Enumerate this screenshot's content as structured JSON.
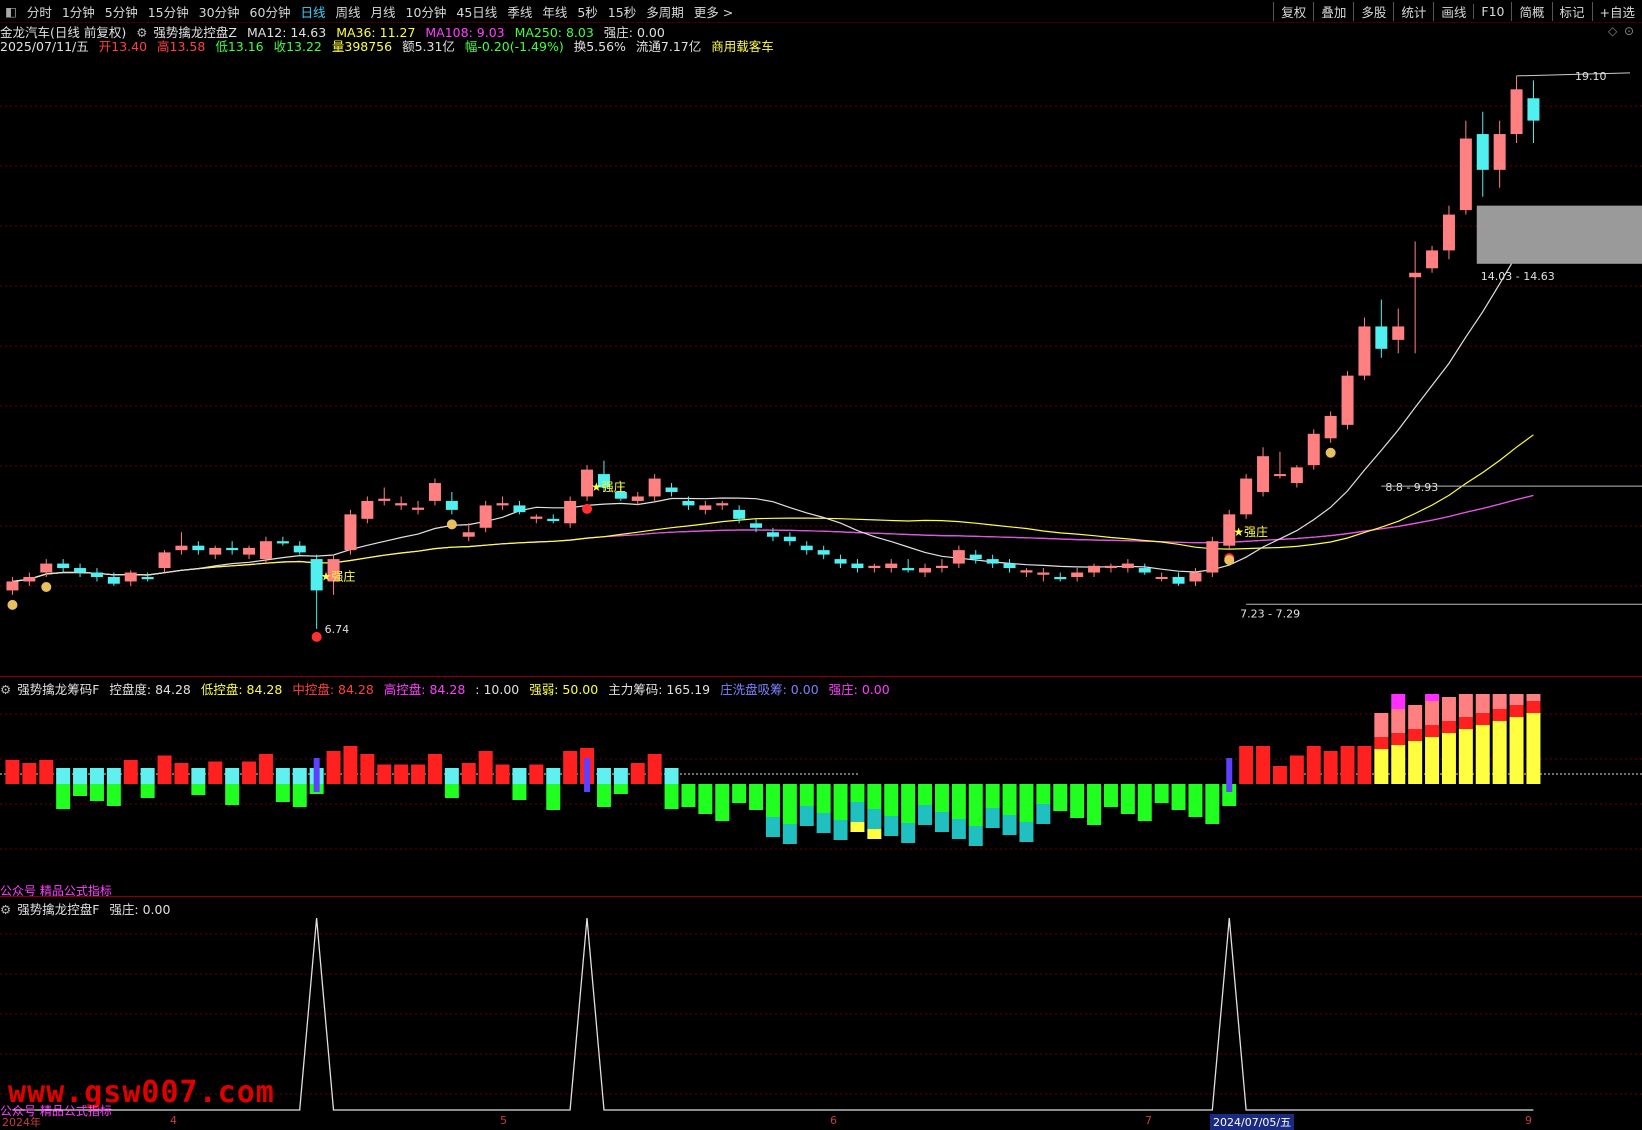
{
  "toolbar": {
    "periods": [
      "分时",
      "1分钟",
      "5分钟",
      "15分钟",
      "30分钟",
      "60分钟",
      "日线",
      "周线",
      "月线",
      "10分钟",
      "45日线",
      "季线",
      "年线",
      "5秒",
      "15秒",
      "多周期",
      "更多 >"
    ],
    "active": "日线",
    "right_items": [
      "复权",
      "叠加",
      "多股",
      "统计",
      "画线",
      "F10",
      "简概",
      "标记",
      "+自选"
    ]
  },
  "price_header": {
    "stock": "金龙汽车(日线 前复权)",
    "indicator": "强势擒龙控盘Z",
    "ma12": "MA12: 14.63",
    "ma36": "MA36: 11.27",
    "ma108": "MA108: 9.03",
    "ma250": "MA250: 8.03",
    "qz": "强庄: 0.00"
  },
  "info_line": {
    "date": "2025/07/11/五",
    "open": "开13.40",
    "high": "高13.58",
    "low": "低13.16",
    "close": "收13.22",
    "vol": "量398756",
    "amount": "额5.31亿",
    "change": "幅-0.20(-1.49%)",
    "turnover": "换5.56%",
    "float": "流通7.17亿",
    "sector": "商用载客车"
  },
  "price_labels": {
    "high": "19.10",
    "low": "6.74",
    "zone1": "14.03 - 14.63",
    "zone2": "8.8 - 9.93",
    "zone3": "7.23 - 7.29",
    "qz_tag": "★强庄"
  },
  "ind1_header": {
    "name": "强势擒龙筹码F",
    "kpd": "控盘度: 84.28",
    "low": "低控盘: 84.28",
    "mid": "中控盘: 84.28",
    "high": "高控盘: 84.28",
    "ten": ": 10.00",
    "qr": "强弱: 50.00",
    "zl": "主力筹码: 165.19",
    "wash": "庄洗盘吸筹: 0.00",
    "qz": "强庄: 0.00"
  },
  "ind2_header": {
    "name": "强势擒龙控盘F",
    "qz": "强庄: 0.00"
  },
  "watermark": {
    "site": "www.gsw007.com",
    "caption": "公众号 精品公式指标"
  },
  "time_axis": [
    "2024年",
    "4",
    "5",
    "6",
    "7",
    "2024/07/05/五",
    "9"
  ],
  "colors": {
    "up": "#ff8080",
    "up_solid": "#ff2020",
    "down": "#50f0f0",
    "ma12": "#e0e0e0",
    "ma36": "#ffff40",
    "ma108": "#ff40ff",
    "ma250": "#40ff40"
  },
  "chart_data": {
    "type": "candlestick",
    "price_range": [
      6.0,
      19.5
    ],
    "candles_ohlc": [
      [
        7.6,
        7.9,
        7.5,
        7.8
      ],
      [
        7.8,
        8.0,
        7.7,
        7.9
      ],
      [
        8.0,
        8.3,
        7.9,
        8.2
      ],
      [
        8.2,
        8.3,
        8.0,
        8.1
      ],
      [
        8.1,
        8.2,
        7.9,
        8.0
      ],
      [
        8.0,
        8.1,
        7.8,
        7.9
      ],
      [
        7.9,
        8.0,
        7.7,
        7.75
      ],
      [
        7.8,
        8.05,
        7.7,
        8.0
      ],
      [
        7.9,
        8.0,
        7.8,
        7.85
      ],
      [
        8.1,
        8.5,
        8.0,
        8.45
      ],
      [
        8.5,
        8.9,
        8.4,
        8.6
      ],
      [
        8.6,
        8.7,
        8.4,
        8.5
      ],
      [
        8.4,
        8.6,
        8.3,
        8.55
      ],
      [
        8.55,
        8.7,
        8.4,
        8.5
      ],
      [
        8.4,
        8.6,
        8.3,
        8.55
      ],
      [
        8.3,
        8.8,
        8.2,
        8.7
      ],
      [
        8.7,
        8.8,
        8.6,
        8.65
      ],
      [
        8.6,
        8.7,
        8.4,
        8.45
      ],
      [
        8.3,
        8.4,
        6.74,
        7.6
      ],
      [
        7.8,
        8.4,
        7.5,
        8.3
      ],
      [
        8.5,
        9.4,
        8.4,
        9.3
      ],
      [
        9.2,
        9.7,
        9.1,
        9.6
      ],
      [
        9.6,
        9.9,
        9.5,
        9.65
      ],
      [
        9.5,
        9.7,
        9.4,
        9.55
      ],
      [
        9.4,
        9.6,
        9.3,
        9.45
      ],
      [
        9.6,
        10.1,
        9.5,
        10.0
      ],
      [
        9.6,
        9.8,
        9.3,
        9.4
      ],
      [
        8.8,
        9.1,
        8.7,
        8.9
      ],
      [
        9.0,
        9.6,
        8.9,
        9.5
      ],
      [
        9.5,
        9.7,
        9.4,
        9.55
      ],
      [
        9.5,
        9.6,
        9.3,
        9.35
      ],
      [
        9.2,
        9.3,
        9.1,
        9.25
      ],
      [
        9.2,
        9.3,
        9.1,
        9.15
      ],
      [
        9.1,
        9.7,
        9.0,
        9.6
      ],
      [
        9.7,
        10.4,
        9.6,
        10.3
      ],
      [
        10.2,
        10.5,
        9.8,
        9.9
      ],
      [
        9.8,
        10.0,
        9.6,
        9.65
      ],
      [
        9.6,
        9.8,
        9.5,
        9.7
      ],
      [
        9.7,
        10.2,
        9.6,
        10.1
      ],
      [
        9.9,
        10.0,
        9.7,
        9.8
      ],
      [
        9.6,
        9.7,
        9.4,
        9.5
      ],
      [
        9.4,
        9.6,
        9.3,
        9.5
      ],
      [
        9.5,
        9.6,
        9.4,
        9.55
      ],
      [
        9.4,
        9.5,
        9.1,
        9.2
      ],
      [
        9.1,
        9.2,
        8.9,
        9.0
      ],
      [
        8.9,
        9.0,
        8.7,
        8.8
      ],
      [
        8.8,
        8.9,
        8.6,
        8.7
      ],
      [
        8.6,
        8.7,
        8.4,
        8.5
      ],
      [
        8.5,
        8.6,
        8.3,
        8.4
      ],
      [
        8.3,
        8.4,
        8.1,
        8.2
      ],
      [
        8.2,
        8.3,
        8.0,
        8.1
      ],
      [
        8.1,
        8.2,
        8.0,
        8.15
      ],
      [
        8.1,
        8.3,
        8.0,
        8.2
      ],
      [
        8.1,
        8.3,
        8.0,
        8.05
      ],
      [
        8.0,
        8.2,
        7.9,
        8.1
      ],
      [
        8.1,
        8.3,
        8.0,
        8.15
      ],
      [
        8.2,
        8.6,
        8.1,
        8.5
      ],
      [
        8.4,
        8.5,
        8.2,
        8.3
      ],
      [
        8.3,
        8.4,
        8.1,
        8.2
      ],
      [
        8.2,
        8.3,
        8.0,
        8.1
      ],
      [
        8.0,
        8.1,
        7.9,
        8.05
      ],
      [
        7.95,
        8.1,
        7.8,
        8.0
      ],
      [
        7.9,
        8.0,
        7.8,
        7.85
      ],
      [
        7.9,
        8.1,
        7.8,
        8.0
      ],
      [
        8.0,
        8.2,
        7.9,
        8.15
      ],
      [
        8.1,
        8.2,
        8.0,
        8.15
      ],
      [
        8.1,
        8.3,
        8.0,
        8.2
      ],
      [
        8.1,
        8.2,
        7.95,
        8.0
      ],
      [
        7.9,
        8.0,
        7.8,
        7.9
      ],
      [
        7.9,
        8.0,
        7.7,
        7.75
      ],
      [
        7.8,
        8.1,
        7.7,
        8.0
      ],
      [
        8.0,
        8.8,
        7.9,
        8.7
      ],
      [
        8.6,
        9.4,
        8.5,
        9.3
      ],
      [
        9.3,
        10.2,
        9.2,
        10.1
      ],
      [
        9.8,
        10.8,
        9.7,
        10.6
      ],
      [
        10.2,
        10.7,
        10.1,
        10.2
      ],
      [
        10.0,
        10.4,
        9.9,
        10.35
      ],
      [
        10.4,
        11.2,
        10.3,
        11.1
      ],
      [
        11.0,
        11.6,
        10.9,
        11.5
      ],
      [
        11.3,
        12.5,
        11.2,
        12.4
      ],
      [
        12.4,
        13.7,
        12.3,
        13.5
      ],
      [
        13.5,
        14.1,
        12.8,
        13.0
      ],
      [
        13.2,
        13.9,
        12.9,
        13.5
      ],
      [
        14.6,
        15.4,
        12.9,
        14.7
      ],
      [
        14.8,
        15.3,
        14.7,
        15.2
      ],
      [
        15.2,
        16.2,
        15.0,
        16.0
      ],
      [
        16.1,
        18.1,
        16.0,
        17.7
      ],
      [
        17.8,
        18.3,
        16.4,
        17.0
      ],
      [
        17.0,
        18.1,
        16.6,
        17.8
      ],
      [
        17.8,
        19.1,
        17.6,
        18.8
      ],
      [
        18.6,
        19.0,
        17.6,
        18.1
      ]
    ]
  }
}
